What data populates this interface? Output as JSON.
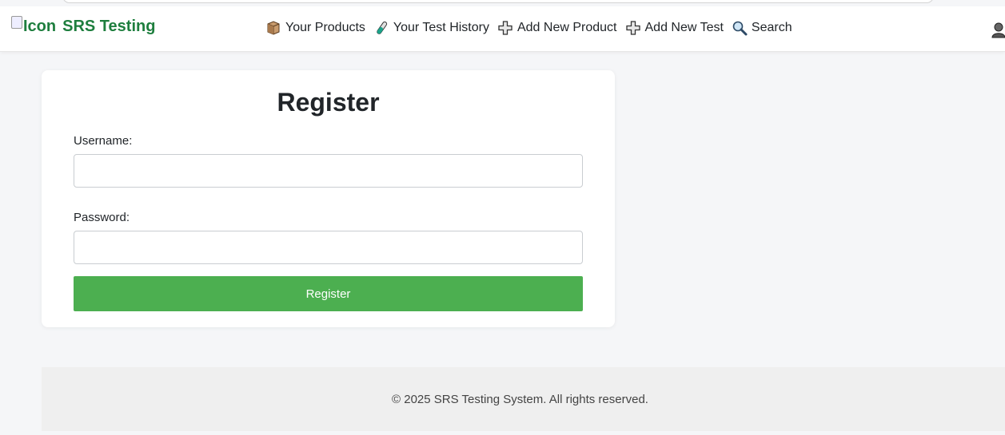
{
  "brand": {
    "logo_alt": "Icon",
    "title": "SRS Testing",
    "color": "#1e7e3e"
  },
  "nav": {
    "items": [
      {
        "label": "Your Products",
        "icon": "package-icon"
      },
      {
        "label": "Your Test History",
        "icon": "test-tube-icon"
      },
      {
        "label": "Add New Product",
        "icon": "plus-icon"
      },
      {
        "label": "Add New Test",
        "icon": "plus-icon"
      },
      {
        "label": "Search",
        "icon": "magnifier-icon"
      }
    ],
    "user_icon": "user-icon"
  },
  "form": {
    "heading": "Register",
    "username_label": "Username:",
    "username_value": "",
    "password_label": "Password:",
    "password_value": "",
    "submit_label": "Register",
    "button_color": "#4caf50"
  },
  "footer": {
    "text": "© 2025 SRS Testing System. All rights reserved."
  }
}
